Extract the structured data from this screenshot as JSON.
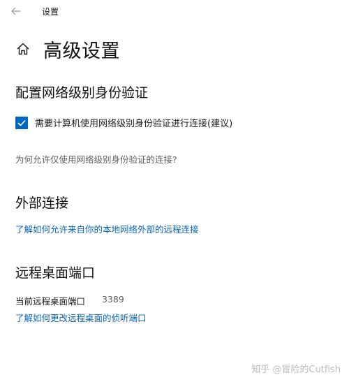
{
  "window": {
    "title": "设置"
  },
  "page": {
    "title": "高级设置"
  },
  "sections": {
    "nla": {
      "heading": "配置网络级别身份验证",
      "checkbox_label": "需要计算机使用网络级别身份验证进行连接(建议)",
      "checkbox_checked": true,
      "question": "为何允许仅使用网络级别身份验证的连接?"
    },
    "external": {
      "heading": "外部连接",
      "link": "了解如何允许来自你的本地网络外部的远程连接"
    },
    "port": {
      "heading": "远程桌面端口",
      "label": "当前远程桌面端口",
      "value": "3389",
      "link": "了解如何更改远程桌面的侦听端口"
    }
  },
  "watermark": "知乎 @冒险的Cutfish",
  "icons": {
    "back": "back-arrow-icon",
    "home": "home-icon",
    "check": "checkmark-icon"
  },
  "colors": {
    "accent": "#0067c0",
    "link": "#0a63b8",
    "secondary_text": "#5f5f5f"
  }
}
